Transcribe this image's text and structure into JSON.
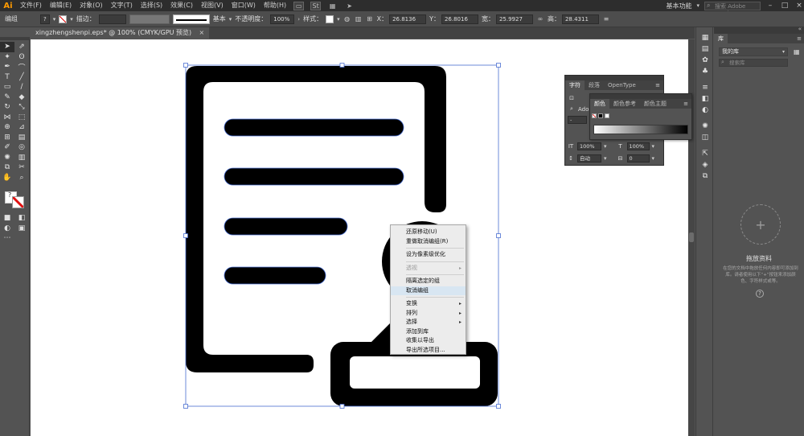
{
  "app": {
    "logo": "Ai",
    "accent": "#ff9a00"
  },
  "menubar": {
    "items": [
      "文件(F)",
      "编辑(E)",
      "对象(O)",
      "文字(T)",
      "选择(S)",
      "效果(C)",
      "视图(V)",
      "窗口(W)",
      "帮助(H)"
    ],
    "icons": [
      "bridge-icon",
      "stock-icon",
      "arrange-documents-icon",
      "send-icon"
    ],
    "workspace": "基本功能",
    "stock_search_placeholder": "搜索 Adobe Stock",
    "window_buttons": [
      "–",
      "□",
      "×"
    ]
  },
  "controlbar": {
    "group_label": "编组",
    "help_glyph": "?",
    "stroke_label": "描边：",
    "stroke_style_label": "基本",
    "opacity_label": "不透明度：",
    "opacity_value": "100%",
    "style_label": "样式：",
    "x_label": "X：",
    "x_value": "26.8136",
    "y_label": "Y：",
    "y_value": "26.8016",
    "w_label": "宽：",
    "w_value": "25.9927",
    "h_label": "高：",
    "h_value": "28.4311"
  },
  "document": {
    "tab_title": "xingzhengshenpi.eps* @ 100% (CMYK/GPU 预览)",
    "close_glyph": "×"
  },
  "tools": {
    "fill_help_glyph": "?"
  },
  "context_menu": {
    "items": [
      {
        "label": "还原移动(U)",
        "enabled": true,
        "submenu": false
      },
      {
        "label": "重做取消编组(R)",
        "enabled": true,
        "submenu": false
      },
      {
        "separator": true
      },
      {
        "label": "设为像素级优化",
        "enabled": true,
        "submenu": false
      },
      {
        "separator": true
      },
      {
        "label": "透视",
        "enabled": false,
        "submenu": true
      },
      {
        "separator": true
      },
      {
        "label": "隔离选定的组",
        "enabled": true,
        "submenu": false
      },
      {
        "label": "取消编组",
        "enabled": true,
        "submenu": false,
        "highlighted": true
      },
      {
        "separator": true
      },
      {
        "label": "变换",
        "enabled": true,
        "submenu": true
      },
      {
        "label": "排列",
        "enabled": true,
        "submenu": true
      },
      {
        "label": "选择",
        "enabled": true,
        "submenu": true
      },
      {
        "label": "添加到库",
        "enabled": true,
        "submenu": false
      },
      {
        "label": "收集以导出",
        "enabled": true,
        "submenu": false
      },
      {
        "label": "导出所选项目...",
        "enabled": true,
        "submenu": false
      }
    ],
    "submenu_glyph": "▸"
  },
  "character_panel": {
    "tabs": [
      "字符",
      "段落",
      "OpenType"
    ],
    "font_prefix": "Adob",
    "size_value": "100%",
    "tracking_value": "100%",
    "leading_value": "自动",
    "kerning_value": "0",
    "small_value": "-"
  },
  "color_panel": {
    "tabs": [
      "颜色",
      "颜色参考",
      "颜色主题"
    ],
    "menu_glyph": "≡"
  },
  "libraries_panel": {
    "tab_label": "库",
    "library_select": "我的库",
    "search_placeholder": "搜索库",
    "drop_title": "拖放资料",
    "drop_description": "在您的文档中拖放任何内容即可添加到库。请者使用以下“+”按钮来添加颜色、字符样式或等。",
    "add_glyph": "+",
    "help_glyph": "?"
  },
  "colors": {
    "menubar_bg": "#2d2d2d",
    "panel_bg": "#535353",
    "artboard": "#ffffff",
    "artwork": "#000000",
    "selection": "#4a6fd1",
    "stroke_none_red": "#e01010"
  }
}
